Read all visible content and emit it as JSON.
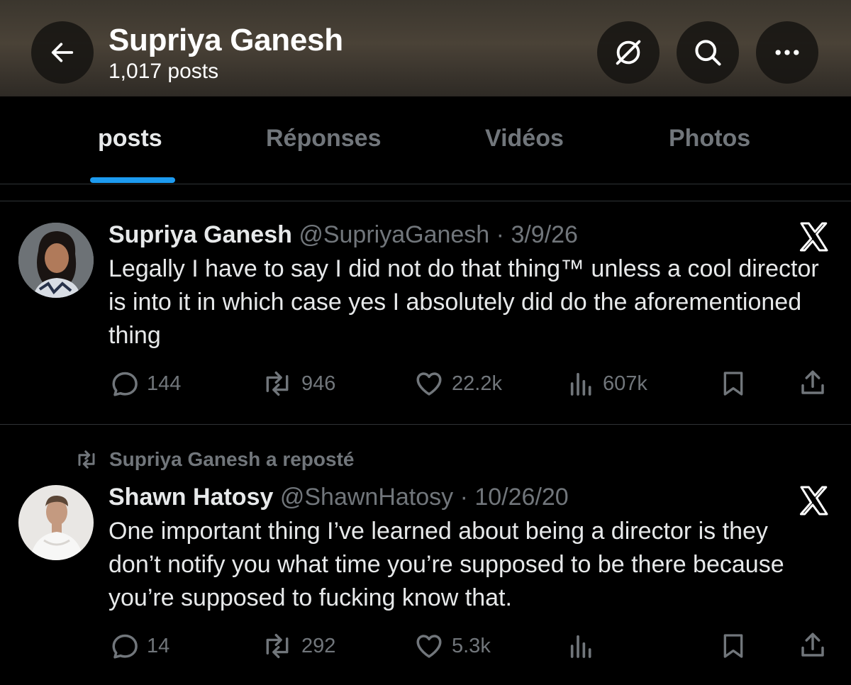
{
  "header": {
    "title": "Supriya Ganesh",
    "post_count": "1,017 posts",
    "icons": [
      "back-arrow-icon",
      "grok-icon",
      "search-icon",
      "more-icon"
    ]
  },
  "tabs": [
    {
      "label": "posts",
      "active": true
    },
    {
      "label": "Réponses",
      "active": false
    },
    {
      "label": "Vidéos",
      "active": false
    },
    {
      "label": "Photos",
      "active": false
    }
  ],
  "tweets": [
    {
      "name": "Supriya Ganesh",
      "handle": "@SupriyaGanesh",
      "sep": " · ",
      "date": "3/9/26",
      "text": "Legally I have to say I did not do that thing™ unless a cool director is into it in which case yes I absolutely did do the aforementioned thing",
      "replies": "144",
      "reposts": "946",
      "likes": "22.2k",
      "views": "607k"
    },
    {
      "repost_note": "Supriya Ganesh a reposté",
      "name": "Shawn Hatosy",
      "handle": "@ShawnHatosy",
      "sep": " · ",
      "date": "10/26/20",
      "text": "One important thing I’ve learned about being a director is they don’t notify you what time you’re supposed to be there because you’re supposed to fucking know that.",
      "replies": "14",
      "reposts": "292",
      "likes": "5.3k",
      "views": ""
    }
  ],
  "colors": {
    "background": "#000000",
    "text": "#e7e9ea",
    "secondary": "#71767b",
    "accent": "#1d9bf0",
    "divider": "#2f3336"
  }
}
